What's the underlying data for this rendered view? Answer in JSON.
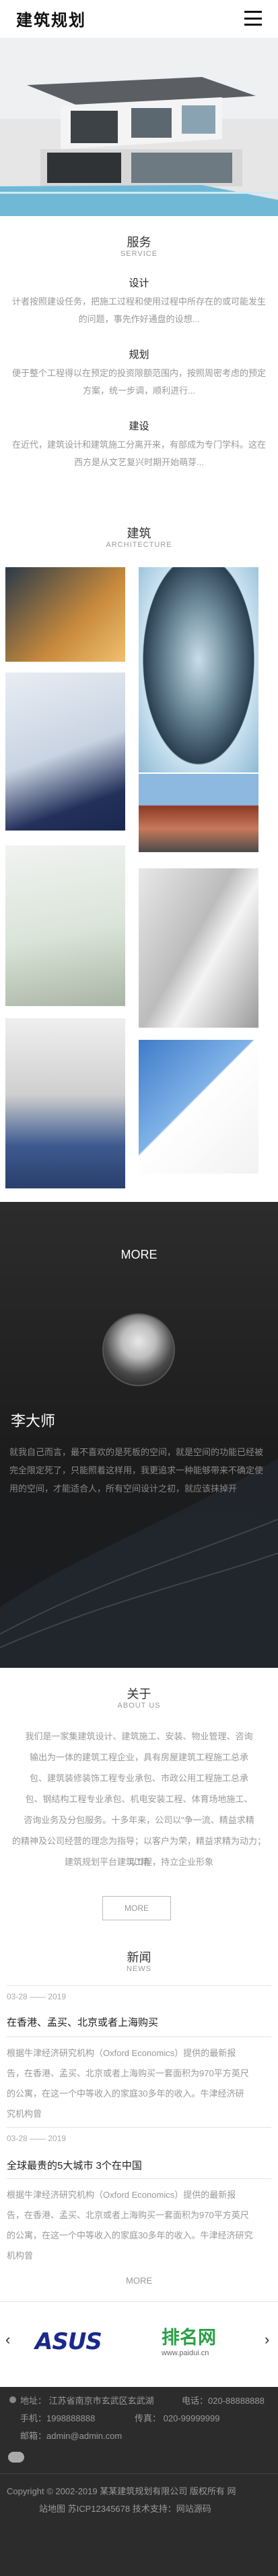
{
  "header": {
    "logo": "建筑规划"
  },
  "services": {
    "title": "服务",
    "subtitle": "SERVICE",
    "items": [
      {
        "title": "设计",
        "desc": "计者按照建设任务，把施工过程和使用过程中所存在的或可能发生的问题，事先作好通盘的设想..."
      },
      {
        "title": "规划",
        "desc": "便于整个工程得以在预定的投资限额范围内，按照周密考虑的预定方案，统一步调，顺利进行..."
      },
      {
        "title": "建设",
        "desc": "在近代，建筑设计和建筑施工分离开来，有部成为专门学科。这在西方是从文艺复兴时期开始萌芽..."
      }
    ]
  },
  "architecture": {
    "title": "建筑",
    "subtitle": "ARCHITECTURE"
  },
  "more": {
    "heading": "MORE",
    "person_name": "李大师",
    "person_desc": "就我自己而言，最不喜欢的是死板的空间，就是空间的功能已经被完全限定死了，只能照着这样用，我更追求一种能够带来不确定使用的空间，才能适合人，所有空间设计之初，就应该抹掉开"
  },
  "about": {
    "title": "关于",
    "subtitle": "ABOUT US",
    "lines": [
      "我们是一家集建筑设计、建筑施工、安装、物业管理、咨询",
      "输出为一体的建筑工程企业，具有房屋建筑工程施工总承",
      "包、建筑装修装饰工程专业承包、市政公用工程施工总承",
      "包、钢结构工程专业承包、机电安装工程、体育场地施工、",
      "咨询业务及分包服务。十多年来，公司以\"争一流、精益求精",
      "的精神及公司经营的理念为指导；以客户为荣，精益求精为动力；以\"精",
      "建筑规划平台建筑工程，持立企业形象"
    ],
    "more_button": "MORE"
  },
  "news": {
    "title": "新闻",
    "subtitle": "NEWS",
    "items": [
      {
        "date": "03-28 —— 2019",
        "title": "在香港、孟买、北京或者上海购买",
        "desc": [
          "根据牛津经济研究机构（Oxford Economics）提供的最新报",
          "告，在香港、孟买、北京或者上海购买一套面积为970平方英尺",
          "的公寓，在这一个中等收入的家庭30多年的收入。牛津经济研",
          "究机构曾"
        ]
      },
      {
        "date": "03-28 —— 2019",
        "title": "全球最贵的5大城市 3个在中国",
        "desc": [
          "根据牛津经济研究机构（Oxford Economics）提供的最新报",
          "告，在香港、孟买、北京或者上海购买一套面积为970平方英尺",
          "的公寓，在这一个中等收入的家庭30多年的收入。牛津经济研究",
          "机构曾"
        ]
      }
    ],
    "more_label": "MORE"
  },
  "partners": {
    "logos": [
      {
        "text": "ASUS"
      },
      {
        "text": "排名网",
        "sub": "www.paidui.cn"
      }
    ]
  },
  "footer": {
    "address": "地址： 江苏省南京市玄武区玄武湖",
    "phone": "电话：020-88888888",
    "mobile": "手机：1998888888",
    "fax": "传真： 020-99999999",
    "email": "邮箱：admin@admin.com",
    "copyright": "Copyright © 2002-2019 某某建筑规划有限公司 版权所有  网",
    "icp": "站地图  苏ICP12345678  技术支持：网站源码"
  },
  "colors": {
    "accent_blue": "#1a2a8c",
    "footer_bg": "#2c2c2c",
    "more_bg": "#222222"
  }
}
